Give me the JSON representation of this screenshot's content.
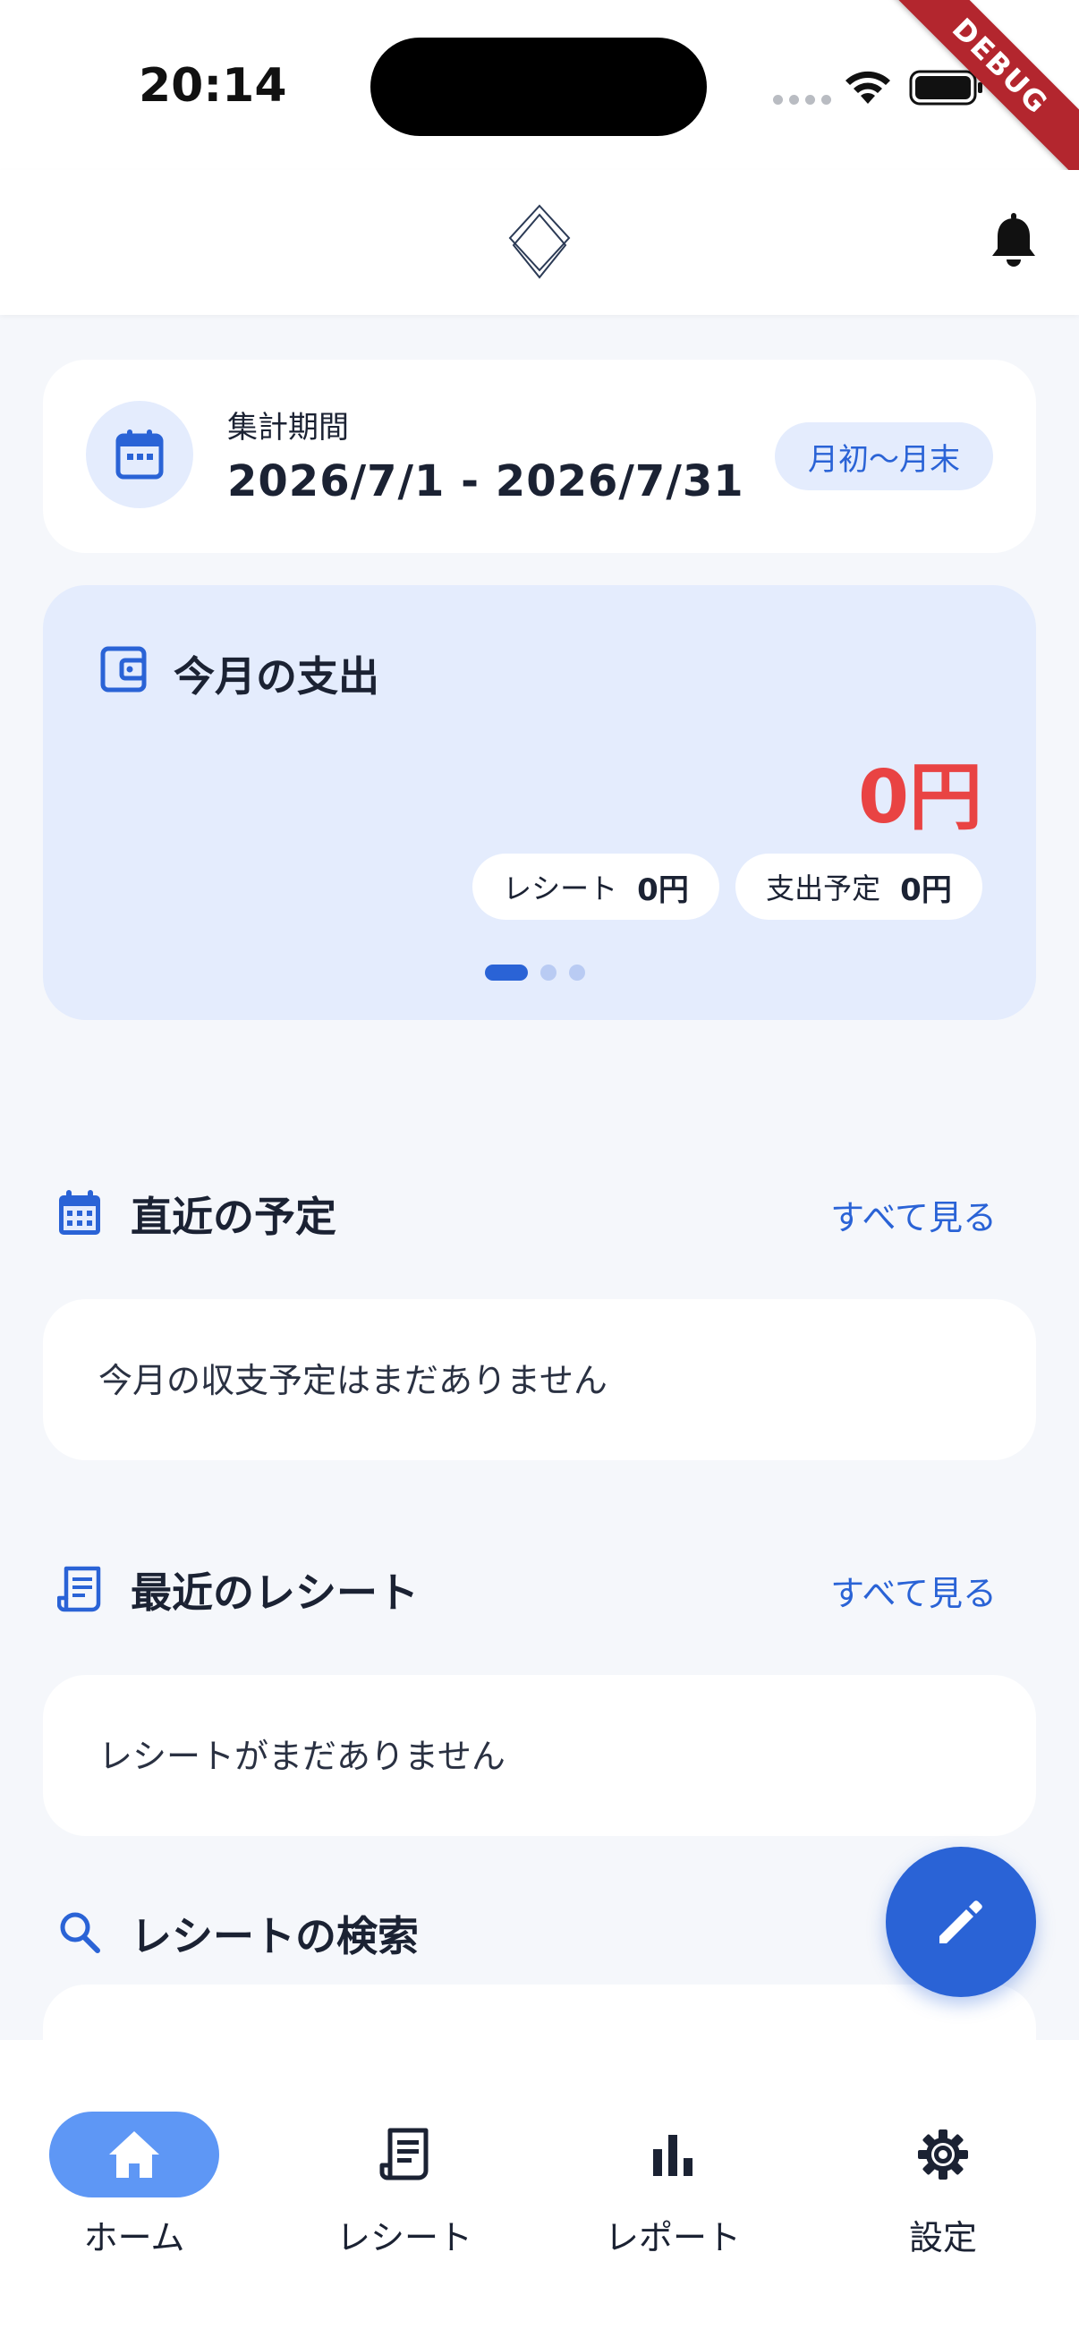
{
  "status": {
    "time": "20:14",
    "debug_label": "DEBUG"
  },
  "period": {
    "label": "集計期間",
    "range": "2026/7/1 - 2026/7/31",
    "chip": "月初〜月末"
  },
  "spend": {
    "title": "今月の支出",
    "total": "0円",
    "receipt_label": "レシート",
    "receipt_value": "0円",
    "planned_label": "支出予定",
    "planned_value": "0円",
    "page_count": 3,
    "active_page": 1
  },
  "upcoming": {
    "title": "直近の予定",
    "link": "すべて見る",
    "empty": "今月の収支予定はまだありません"
  },
  "receipts": {
    "title": "最近のレシート",
    "link": "すべて見る",
    "empty": "レシートがまだありません"
  },
  "search": {
    "title": "レシートの検索"
  },
  "nav": {
    "home": "ホーム",
    "receipt": "レシート",
    "report": "レポート",
    "settings": "設定"
  },
  "colors": {
    "accent": "#2a63d6",
    "accent_light": "#e4ecfd",
    "danger": "#e94343",
    "nav_active": "#5e97f5"
  }
}
